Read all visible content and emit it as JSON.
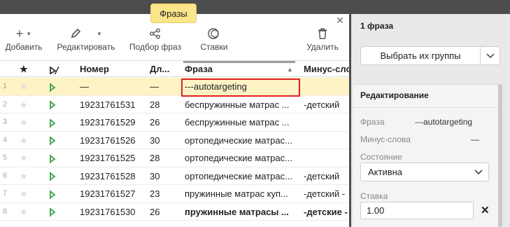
{
  "tab": {
    "label": "Фразы"
  },
  "toolbar": {
    "add_label": "Добавить",
    "edit_label": "Редактировать",
    "phrase_selection_label": "Подбор фраз",
    "bids_label": "Ставки",
    "delete_label": "Удалить"
  },
  "table": {
    "headers": {
      "star": "★",
      "number": "Номер",
      "length": "Дл...",
      "phrase": "Фраза",
      "minus": "Минус-сло"
    },
    "rows": [
      {
        "idx": "1",
        "number": "—",
        "length": "—",
        "phrase": "---autotargeting",
        "minus": "",
        "bold": false,
        "selected": true
      },
      {
        "idx": "2",
        "number": "19231761531",
        "length": "28",
        "phrase": "беспружинные матрас ...",
        "minus": "-детский",
        "bold": false
      },
      {
        "idx": "3",
        "number": "19231761529",
        "length": "26",
        "phrase": "беспружинные матрас ...",
        "minus": "",
        "bold": false
      },
      {
        "idx": "4",
        "number": "19231761526",
        "length": "30",
        "phrase": "ортопедические матрас...",
        "minus": "",
        "bold": false
      },
      {
        "idx": "5",
        "number": "19231761525",
        "length": "28",
        "phrase": "ортопедические матрас...",
        "minus": "",
        "bold": false
      },
      {
        "idx": "6",
        "number": "19231761528",
        "length": "30",
        "phrase": "ортопедические матрас...",
        "minus": "-детский",
        "bold": false
      },
      {
        "idx": "7",
        "number": "19231761527",
        "length": "23",
        "phrase": "пружинные матрас куп...",
        "minus": "-детский -",
        "bold": false
      },
      {
        "idx": "8",
        "number": "19231761530",
        "length": "26",
        "phrase": "пружинные матрасы ...",
        "minus": "-детские -",
        "bold": true
      }
    ]
  },
  "right_panel": {
    "title": "1 фраза",
    "group_button_label": "Выбрать их группы",
    "edit_title": "Редактирование",
    "phrase_label": "Фраза",
    "phrase_value": "---autotargeting",
    "minus_label": "Минус-слова",
    "minus_value": "—",
    "state_label": "Состояние",
    "state_value": "Активна",
    "bid_label": "Ставка",
    "bid_value": "1.00"
  },
  "colors": {
    "tab_yellow": "#fbe48a",
    "selected_row": "#fdf3c4",
    "highlight_border": "#e02020",
    "flag_green": "#3aa648"
  },
  "icons": [
    "plus-icon",
    "pencil-icon",
    "share-nodes-icon",
    "coins-icon",
    "trash-icon",
    "star-icon",
    "flag-icon",
    "close-icon",
    "chevron-down-icon",
    "clear-x-icon"
  ]
}
